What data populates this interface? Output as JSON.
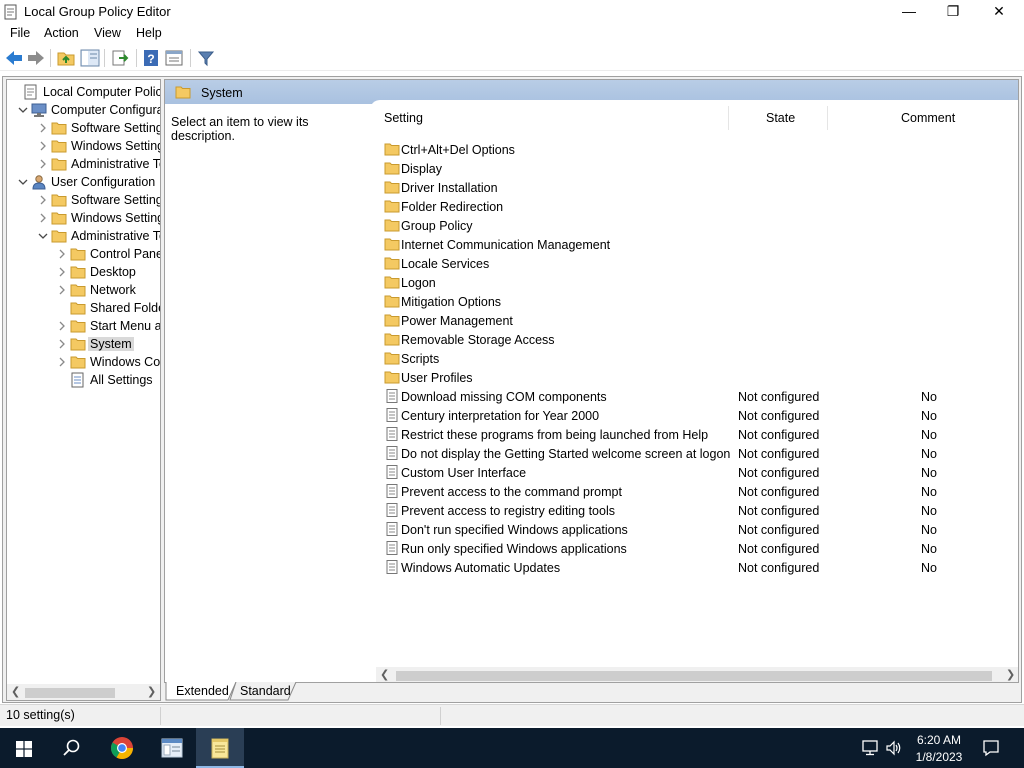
{
  "window": {
    "title": "Local Group Policy Editor",
    "minimize_glyph": "—",
    "restore_glyph": "❐",
    "close_glyph": "✕"
  },
  "menu": [
    "File",
    "Action",
    "View",
    "Help"
  ],
  "toolbar": {
    "icons": [
      "back-arrow-icon",
      "forward-arrow-icon",
      "up-folder-icon",
      "show-hide-tree-icon",
      "export-list-icon",
      "help-icon",
      "properties-icon",
      "filter-icon"
    ]
  },
  "tree": [
    {
      "label": "Local Computer Policy",
      "icon": "policy-icon",
      "expand": "",
      "indent": 0
    },
    {
      "label": "Computer Configuration",
      "icon": "computer-icon",
      "expand": "expanded",
      "indent": 1
    },
    {
      "label": "Software Settings",
      "icon": "folder-icon",
      "expand": "collapsed",
      "indent": 2
    },
    {
      "label": "Windows Settings",
      "icon": "folder-icon",
      "expand": "collapsed",
      "indent": 2
    },
    {
      "label": "Administrative Templates",
      "icon": "folder-icon",
      "expand": "collapsed",
      "indent": 2
    },
    {
      "label": "User Configuration",
      "icon": "user-icon",
      "expand": "expanded",
      "indent": 1
    },
    {
      "label": "Software Settings",
      "icon": "folder-icon",
      "expand": "collapsed",
      "indent": 2
    },
    {
      "label": "Windows Settings",
      "icon": "folder-icon",
      "expand": "collapsed",
      "indent": 2
    },
    {
      "label": "Administrative Templates",
      "icon": "folder-icon",
      "expand": "expanded",
      "indent": 2
    },
    {
      "label": "Control Panel",
      "icon": "folder-icon",
      "expand": "collapsed",
      "indent": 3
    },
    {
      "label": "Desktop",
      "icon": "folder-icon",
      "expand": "collapsed",
      "indent": 3
    },
    {
      "label": "Network",
      "icon": "folder-icon",
      "expand": "collapsed",
      "indent": 3
    },
    {
      "label": "Shared Folders",
      "icon": "folder-icon",
      "expand": "",
      "indent": 3
    },
    {
      "label": "Start Menu and Taskbar",
      "icon": "folder-icon",
      "expand": "collapsed",
      "indent": 3
    },
    {
      "label": "System",
      "icon": "folder-icon",
      "expand": "collapsed",
      "indent": 3,
      "selected": true
    },
    {
      "label": "Windows Components",
      "icon": "folder-icon",
      "expand": "collapsed",
      "indent": 3
    },
    {
      "label": "All Settings",
      "icon": "all-settings-icon",
      "expand": "",
      "indent": 3
    }
  ],
  "details": {
    "header_title": "System",
    "description": "Select an item to view its description.",
    "columns": {
      "setting": "Setting",
      "state": "State",
      "comment": "Comment"
    },
    "rows": [
      {
        "name": "Ctrl+Alt+Del Options",
        "type": "folder",
        "state": "",
        "comment": ""
      },
      {
        "name": "Display",
        "type": "folder",
        "state": "",
        "comment": ""
      },
      {
        "name": "Driver Installation",
        "type": "folder",
        "state": "",
        "comment": ""
      },
      {
        "name": "Folder Redirection",
        "type": "folder",
        "state": "",
        "comment": ""
      },
      {
        "name": "Group Policy",
        "type": "folder",
        "state": "",
        "comment": ""
      },
      {
        "name": "Internet Communication Management",
        "type": "folder",
        "state": "",
        "comment": ""
      },
      {
        "name": "Locale Services",
        "type": "folder",
        "state": "",
        "comment": ""
      },
      {
        "name": "Logon",
        "type": "folder",
        "state": "",
        "comment": ""
      },
      {
        "name": "Mitigation Options",
        "type": "folder",
        "state": "",
        "comment": ""
      },
      {
        "name": "Power Management",
        "type": "folder",
        "state": "",
        "comment": ""
      },
      {
        "name": "Removable Storage Access",
        "type": "folder",
        "state": "",
        "comment": ""
      },
      {
        "name": "Scripts",
        "type": "folder",
        "state": "",
        "comment": ""
      },
      {
        "name": "User Profiles",
        "type": "folder",
        "state": "",
        "comment": ""
      },
      {
        "name": "Download missing COM components",
        "type": "setting",
        "state": "Not configured",
        "comment": "No"
      },
      {
        "name": "Century interpretation for Year 2000",
        "type": "setting",
        "state": "Not configured",
        "comment": "No"
      },
      {
        "name": "Restrict these programs from being launched from Help",
        "type": "setting",
        "state": "Not configured",
        "comment": "No"
      },
      {
        "name": "Do not display the Getting Started welcome screen at logon",
        "type": "setting",
        "state": "Not configured",
        "comment": "No"
      },
      {
        "name": "Custom User Interface",
        "type": "setting",
        "state": "Not configured",
        "comment": "No"
      },
      {
        "name": "Prevent access to the command prompt",
        "type": "setting",
        "state": "Not configured",
        "comment": "No"
      },
      {
        "name": "Prevent access to registry editing tools",
        "type": "setting",
        "state": "Not configured",
        "comment": "No"
      },
      {
        "name": "Don't run specified Windows applications",
        "type": "setting",
        "state": "Not configured",
        "comment": "No"
      },
      {
        "name": "Run only specified Windows applications",
        "type": "setting",
        "state": "Not configured",
        "comment": "No"
      },
      {
        "name": "Windows Automatic Updates",
        "type": "setting",
        "state": "Not configured",
        "comment": "No"
      }
    ]
  },
  "tabs": {
    "extended": "Extended",
    "standard": "Standard"
  },
  "status": {
    "text": "10 setting(s)"
  },
  "taskbar": {
    "apps": [
      "windows-start-icon",
      "search-icon",
      "chrome-icon",
      "mmc-icon",
      "notepad-icon"
    ],
    "time": "6:20 AM",
    "date": "1/8/2023",
    "tray_icons": [
      "network-icon",
      "volume-icon",
      "notification-icon"
    ]
  },
  "colors": {
    "header_band": "#b4cae6",
    "taskbar": "#0b1b2c",
    "folder_yellow": "#f4c962",
    "selection": "#d9d9d9"
  }
}
